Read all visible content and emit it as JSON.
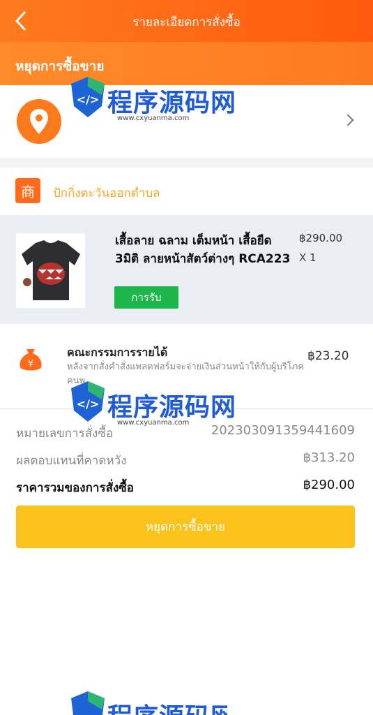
{
  "header": {
    "title": "รายละเอียดการสั่งซื้อ"
  },
  "status_banner": {
    "text": "หยุดการซื้อขาย"
  },
  "shop": {
    "name": "ปักกิ่งตะวันออกตำบล"
  },
  "product": {
    "name": "เสื้อลาย ฉลาม เต็มหน้า เสื้อยืด 3มิติ ลายหน้าสัตว์ต่างๆ RCA223",
    "price": "฿290.00",
    "quantity": "X 1",
    "badge": "การรับ"
  },
  "commission": {
    "title": "คณะกรรมการรายได้",
    "description": "หลังจากสั่งคำสั่งแพลตฟอร์มจะจ่ายเงินส่วนหน้าให้กับผู้บริโภคคนพ",
    "amount": "฿23.20"
  },
  "summary": {
    "order_no_label": "หมายเลขการสั่งซื้อ",
    "order_no": "202303091359441609",
    "expected_return_label": "ผลตอบแทนที่คาดหวัง",
    "expected_return": "฿313.20",
    "total_label": "ราคารวมของการสั่งซื้อ",
    "total": "฿290.00"
  },
  "action": {
    "label": "หยุดการซื้อขาย"
  },
  "watermark": {
    "text": "程序源码网",
    "url": "www.cxyuanma.com"
  },
  "colors": {
    "header": "#ff6a1a",
    "badge": "#1cb64d",
    "cta": "#fbc21c",
    "shop_name": "#f5a623"
  }
}
